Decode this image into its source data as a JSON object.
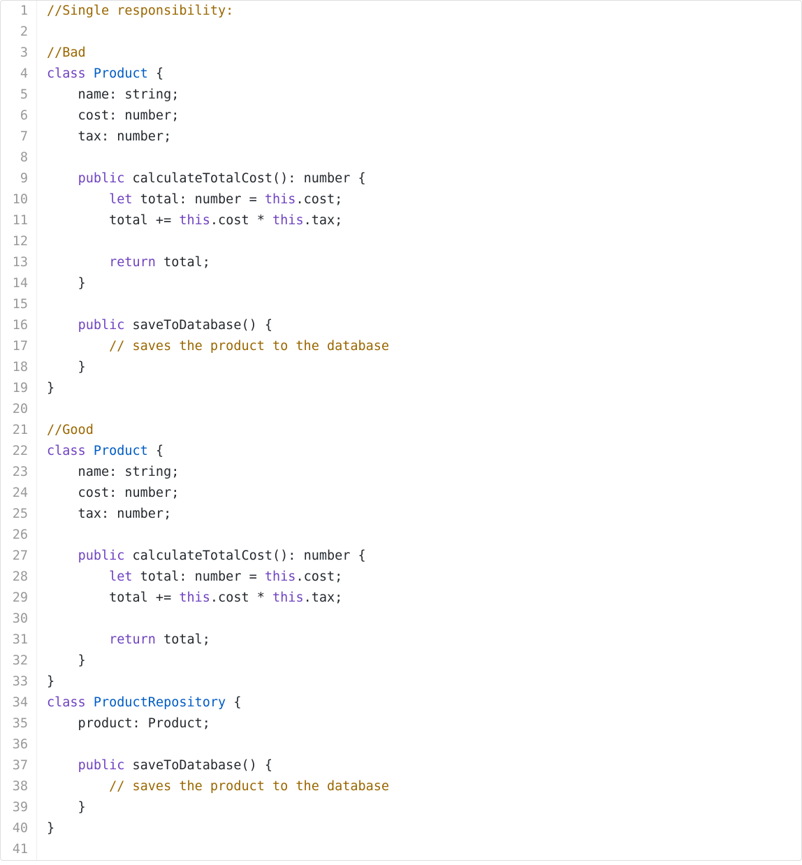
{
  "code": {
    "lines": [
      [
        {
          "t": "comment",
          "s": "//Single responsibility:"
        }
      ],
      [],
      [
        {
          "t": "comment",
          "s": "//Bad"
        }
      ],
      [
        {
          "t": "keyword",
          "s": "class"
        },
        {
          "t": "plain",
          "s": " "
        },
        {
          "t": "type",
          "s": "Product"
        },
        {
          "t": "plain",
          "s": " {"
        }
      ],
      [
        {
          "t": "plain",
          "s": "    name: string;"
        }
      ],
      [
        {
          "t": "plain",
          "s": "    cost: number;"
        }
      ],
      [
        {
          "t": "plain",
          "s": "    tax: number;"
        }
      ],
      [],
      [
        {
          "t": "plain",
          "s": "    "
        },
        {
          "t": "keyword",
          "s": "public"
        },
        {
          "t": "plain",
          "s": " calculateTotalCost(): number {"
        }
      ],
      [
        {
          "t": "plain",
          "s": "        "
        },
        {
          "t": "keyword",
          "s": "let"
        },
        {
          "t": "plain",
          "s": " total: number = "
        },
        {
          "t": "keyword",
          "s": "this"
        },
        {
          "t": "plain",
          "s": ".cost;"
        }
      ],
      [
        {
          "t": "plain",
          "s": "        total += "
        },
        {
          "t": "keyword",
          "s": "this"
        },
        {
          "t": "plain",
          "s": ".cost * "
        },
        {
          "t": "keyword",
          "s": "this"
        },
        {
          "t": "plain",
          "s": ".tax;"
        }
      ],
      [],
      [
        {
          "t": "plain",
          "s": "        "
        },
        {
          "t": "keyword",
          "s": "return"
        },
        {
          "t": "plain",
          "s": " total;"
        }
      ],
      [
        {
          "t": "plain",
          "s": "    }"
        }
      ],
      [],
      [
        {
          "t": "plain",
          "s": "    "
        },
        {
          "t": "keyword",
          "s": "public"
        },
        {
          "t": "plain",
          "s": " saveToDatabase() {"
        }
      ],
      [
        {
          "t": "plain",
          "s": "        "
        },
        {
          "t": "comment",
          "s": "// saves the product to the database"
        }
      ],
      [
        {
          "t": "plain",
          "s": "    }"
        }
      ],
      [
        {
          "t": "plain",
          "s": "}"
        }
      ],
      [],
      [
        {
          "t": "comment",
          "s": "//Good"
        }
      ],
      [
        {
          "t": "keyword",
          "s": "class"
        },
        {
          "t": "plain",
          "s": " "
        },
        {
          "t": "type",
          "s": "Product"
        },
        {
          "t": "plain",
          "s": " {"
        }
      ],
      [
        {
          "t": "plain",
          "s": "    name: string;"
        }
      ],
      [
        {
          "t": "plain",
          "s": "    cost: number;"
        }
      ],
      [
        {
          "t": "plain",
          "s": "    tax: number;"
        }
      ],
      [],
      [
        {
          "t": "plain",
          "s": "    "
        },
        {
          "t": "keyword",
          "s": "public"
        },
        {
          "t": "plain",
          "s": " calculateTotalCost(): number {"
        }
      ],
      [
        {
          "t": "plain",
          "s": "        "
        },
        {
          "t": "keyword",
          "s": "let"
        },
        {
          "t": "plain",
          "s": " total: number = "
        },
        {
          "t": "keyword",
          "s": "this"
        },
        {
          "t": "plain",
          "s": ".cost;"
        }
      ],
      [
        {
          "t": "plain",
          "s": "        total += "
        },
        {
          "t": "keyword",
          "s": "this"
        },
        {
          "t": "plain",
          "s": ".cost * "
        },
        {
          "t": "keyword",
          "s": "this"
        },
        {
          "t": "plain",
          "s": ".tax;"
        }
      ],
      [],
      [
        {
          "t": "plain",
          "s": "        "
        },
        {
          "t": "keyword",
          "s": "return"
        },
        {
          "t": "plain",
          "s": " total;"
        }
      ],
      [
        {
          "t": "plain",
          "s": "    }"
        }
      ],
      [
        {
          "t": "plain",
          "s": "}"
        }
      ],
      [
        {
          "t": "keyword",
          "s": "class"
        },
        {
          "t": "plain",
          "s": " "
        },
        {
          "t": "type",
          "s": "ProductRepository"
        },
        {
          "t": "plain",
          "s": " {"
        }
      ],
      [
        {
          "t": "plain",
          "s": "    product: Product;"
        }
      ],
      [],
      [
        {
          "t": "plain",
          "s": "    "
        },
        {
          "t": "keyword",
          "s": "public"
        },
        {
          "t": "plain",
          "s": " saveToDatabase() {"
        }
      ],
      [
        {
          "t": "plain",
          "s": "        "
        },
        {
          "t": "comment",
          "s": "// saves the product to the database"
        }
      ],
      [
        {
          "t": "plain",
          "s": "    }"
        }
      ],
      [
        {
          "t": "plain",
          "s": "}"
        }
      ],
      []
    ]
  }
}
